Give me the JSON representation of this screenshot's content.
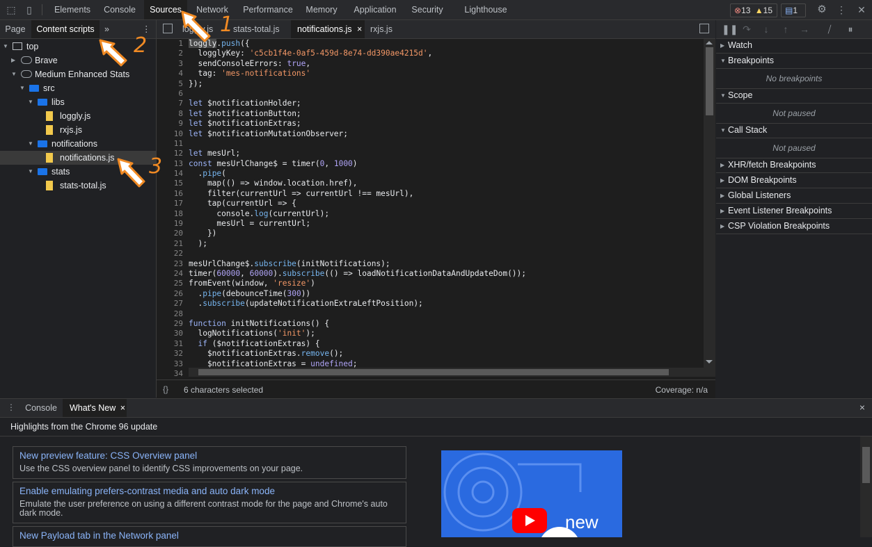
{
  "topbar": {
    "tabs": [
      "Elements",
      "Console",
      "Sources",
      "Network",
      "Performance",
      "Memory",
      "Application",
      "Security",
      "Lighthouse"
    ],
    "active_tab": "Sources",
    "errors": "13",
    "warnings": "15",
    "messages": "1"
  },
  "navigator": {
    "tabs": [
      "Page",
      "Content scripts"
    ],
    "more": "»",
    "tree": [
      {
        "label": "top",
        "type": "frame",
        "depth": 0,
        "expanded": true
      },
      {
        "label": "Brave",
        "type": "cloud",
        "depth": 1,
        "expanded": false
      },
      {
        "label": "Medium Enhanced Stats",
        "type": "cloud",
        "depth": 1,
        "expanded": true
      },
      {
        "label": "src",
        "type": "folder",
        "depth": 2,
        "expanded": true
      },
      {
        "label": "libs",
        "type": "folder",
        "depth": 3,
        "expanded": true
      },
      {
        "label": "loggly.js",
        "type": "file",
        "depth": 4
      },
      {
        "label": "rxjs.js",
        "type": "file",
        "depth": 4
      },
      {
        "label": "notifications",
        "type": "folder",
        "depth": 3,
        "expanded": true
      },
      {
        "label": "notifications.js",
        "type": "file",
        "depth": 4,
        "selected": true
      },
      {
        "label": "stats",
        "type": "folder",
        "depth": 3,
        "expanded": true
      },
      {
        "label": "stats-total.js",
        "type": "file",
        "depth": 4
      }
    ]
  },
  "editor": {
    "tabs": [
      {
        "label": "loggly.js"
      },
      {
        "label": "stats-total.js"
      },
      {
        "label": "notifications.js",
        "active": true,
        "close": "×"
      },
      {
        "label": "rxjs.js"
      }
    ],
    "status_left": "6 characters selected",
    "status_right": "Coverage: n/a",
    "pretty_print": "{}",
    "code": [
      "loggly.push({",
      "  logglyKey: 'c5cb1f4e-0af5-459d-8e74-dd390ae4215d',",
      "  sendConsoleErrors: true,",
      "  tag: 'mes-notifications'",
      "});",
      "",
      "let $notificationHolder;",
      "let $notificationButton;",
      "let $notificationExtras;",
      "let $notificationMutationObserver;",
      "",
      "let mesUrl;",
      "const mesUrlChange$ = timer(0, 1000)",
      "  .pipe(",
      "    map(() => window.location.href),",
      "    filter(currentUrl => currentUrl !== mesUrl),",
      "    tap(currentUrl => {",
      "      console.log(currentUrl);",
      "      mesUrl = currentUrl;",
      "    })",
      "  );",
      "",
      "mesUrlChange$.subscribe(initNotifications);",
      "timer(60000, 60000).subscribe(() => loadNotificationDataAndUpdateDom());",
      "fromEvent(window, 'resize')",
      "  .pipe(debounceTime(300))",
      "  .subscribe(updateNotificationExtraLeftPosition);",
      "",
      "function initNotifications() {",
      "  logNotifications('init');",
      "  if ($notificationExtras) {",
      "    $notificationExtras.remove();",
      "    $notificationExtras = undefined;",
      ""
    ]
  },
  "debugger": {
    "sections": [
      {
        "label": "Watch",
        "expanded": false
      },
      {
        "label": "Breakpoints",
        "expanded": true,
        "empty": "No breakpoints"
      },
      {
        "label": "Scope",
        "expanded": true,
        "empty": "Not paused"
      },
      {
        "label": "Call Stack",
        "expanded": true,
        "empty": "Not paused"
      },
      {
        "label": "XHR/fetch Breakpoints",
        "expanded": false
      },
      {
        "label": "DOM Breakpoints",
        "expanded": false
      },
      {
        "label": "Global Listeners",
        "expanded": false
      },
      {
        "label": "Event Listener Breakpoints",
        "expanded": false
      },
      {
        "label": "CSP Violation Breakpoints",
        "expanded": false
      }
    ]
  },
  "drawer": {
    "tabs": [
      "Console",
      "What's New"
    ],
    "active_tab": "What's New",
    "close_tab": "×",
    "close_drawer": "×",
    "headline": "Highlights from the Chrome 96 update",
    "cards": [
      {
        "title": "New preview feature: CSS Overview panel",
        "desc": "Use the CSS overview panel to identify CSS improvements on your page."
      },
      {
        "title": "Enable emulating prefers-contrast media and auto dark mode",
        "desc": "Emulate the user preference on using a different contrast mode for the page and Chrome's auto dark mode."
      },
      {
        "title": "New Payload tab in the Network panel",
        "desc": ""
      }
    ],
    "video_text": "new"
  },
  "annotations": [
    "1",
    "2",
    "3"
  ],
  "colors": {
    "accent": "#1a73e8",
    "arrow": "#f08a24",
    "folder": "#1a73e8",
    "file": "#f2c94c"
  }
}
